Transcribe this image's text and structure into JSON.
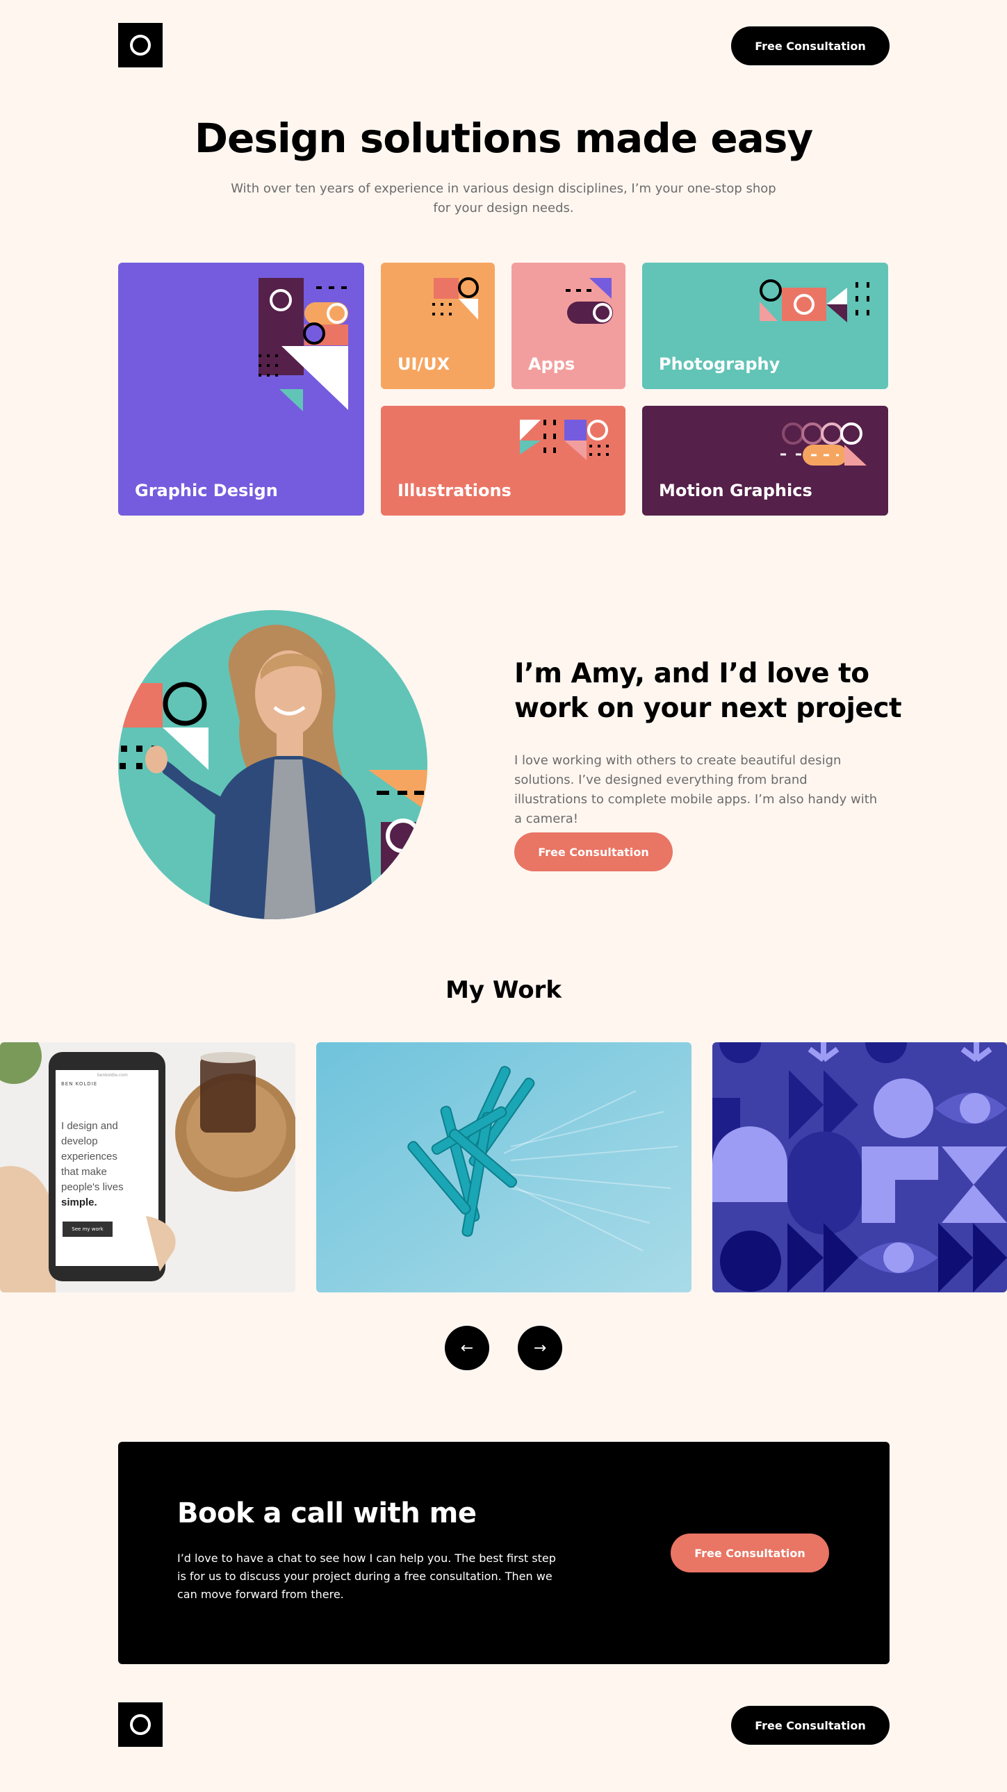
{
  "header": {
    "cta_label": "Free Consultation"
  },
  "hero": {
    "title": "Design solutions made easy",
    "subtitle": "With over ten years of experience in various design disciplines, I’m your one-stop shop for your design needs."
  },
  "services": [
    {
      "label": "Graphic Design",
      "color": "#755CDE"
    },
    {
      "label": "UI/UX",
      "color": "#F6A560"
    },
    {
      "label": "Apps",
      "color": "#F39E9E"
    },
    {
      "label": "Photography",
      "color": "#61C4B7"
    },
    {
      "label": "Illustrations",
      "color": "#EB7565"
    },
    {
      "label": "Motion Graphics",
      "color": "#552049"
    }
  ],
  "about": {
    "title": "I’m Amy, and I’d love to work on your next project",
    "text": "I love working with others to create beautiful design solutions. I’ve designed everything from brand illustrations to complete mobile apps. I’m also handy with a camera!",
    "cta_label": "Free Consultation"
  },
  "work": {
    "title": "My Work",
    "phone_screen": {
      "site_name": "BEN KOLDIE",
      "url": "benkoldie.com",
      "lines": [
        "I design and",
        "develop",
        "experiences",
        "that make",
        "people's lives"
      ],
      "emphasis": "simple.",
      "button": "See my work"
    }
  },
  "cta": {
    "title": "Book a call with me",
    "text": "I’d love to have a chat to see how I can help you. The best first step is for us to discuss your project during a free consultation. Then we can move forward from there.",
    "button_label": "Free Consultation"
  },
  "footer": {
    "cta_label": "Free Consultation"
  },
  "colors": {
    "background": "#FFF6F0",
    "accent": "#E97564",
    "purple": "#755CDE",
    "teal": "#61C4B7",
    "plum": "#552049"
  }
}
